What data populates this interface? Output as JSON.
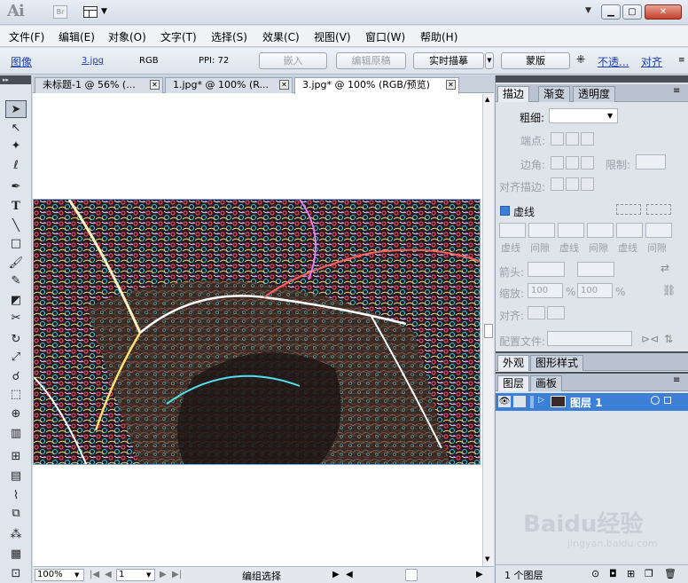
{
  "app": {
    "logo": "Ai",
    "bridge": "Br"
  },
  "menu": [
    "文件(F)",
    "编辑(E)",
    "对象(O)",
    "文字(T)",
    "选择(S)",
    "效果(C)",
    "视图(V)",
    "窗口(W)",
    "帮助(H)"
  ],
  "control": {
    "type_label": "图像",
    "file_link": "3.jpg",
    "color_mode": "RGB",
    "ppi": "PPI: 72",
    "embed": "嵌入",
    "edit_original": "编辑原稿",
    "live_trace": "实时描摹",
    "mask": "蒙版",
    "opacity_link": "不透...",
    "align_link": "对齐"
  },
  "tabs": [
    {
      "label": "未标题-1 @ 56% (..."
    },
    {
      "label": "1.jpg* @ 100% (R..."
    },
    {
      "label": "3.jpg* @ 100% (RGB/预览)"
    }
  ],
  "status": {
    "zoom": "100%",
    "page": "1",
    "mode": "编组选择"
  },
  "stroke_panel": {
    "tabs": [
      "描边",
      "渐变",
      "透明度"
    ],
    "weight_label": "粗细:",
    "cap_label": "端点:",
    "corner_label": "边角:",
    "limit_label": "限制:",
    "align_label": "对齐描边:",
    "dashed_label": "虚线",
    "dash_labels": [
      "虚线",
      "间隙",
      "虚线",
      "间隙",
      "虚线",
      "间隙"
    ],
    "arrow_label": "箭头:",
    "scale_label": "缩放:",
    "scale_values": [
      "100",
      "100"
    ],
    "pct": "%",
    "align2_label": "对齐:",
    "profile_label": "配置文件:"
  },
  "appearance_panel": {
    "tabs": [
      "外观",
      "图形样式"
    ]
  },
  "layers_panel": {
    "tabs": [
      "图层",
      "画板"
    ],
    "layer_name": "图层 1",
    "footer_count": "1 个图层"
  },
  "watermark": {
    "text": "Baidu经验",
    "url": "jingyan.baidu.com"
  },
  "colors": {
    "layer_highlight": "#3b7fd6",
    "close_red": "#c6402b"
  }
}
